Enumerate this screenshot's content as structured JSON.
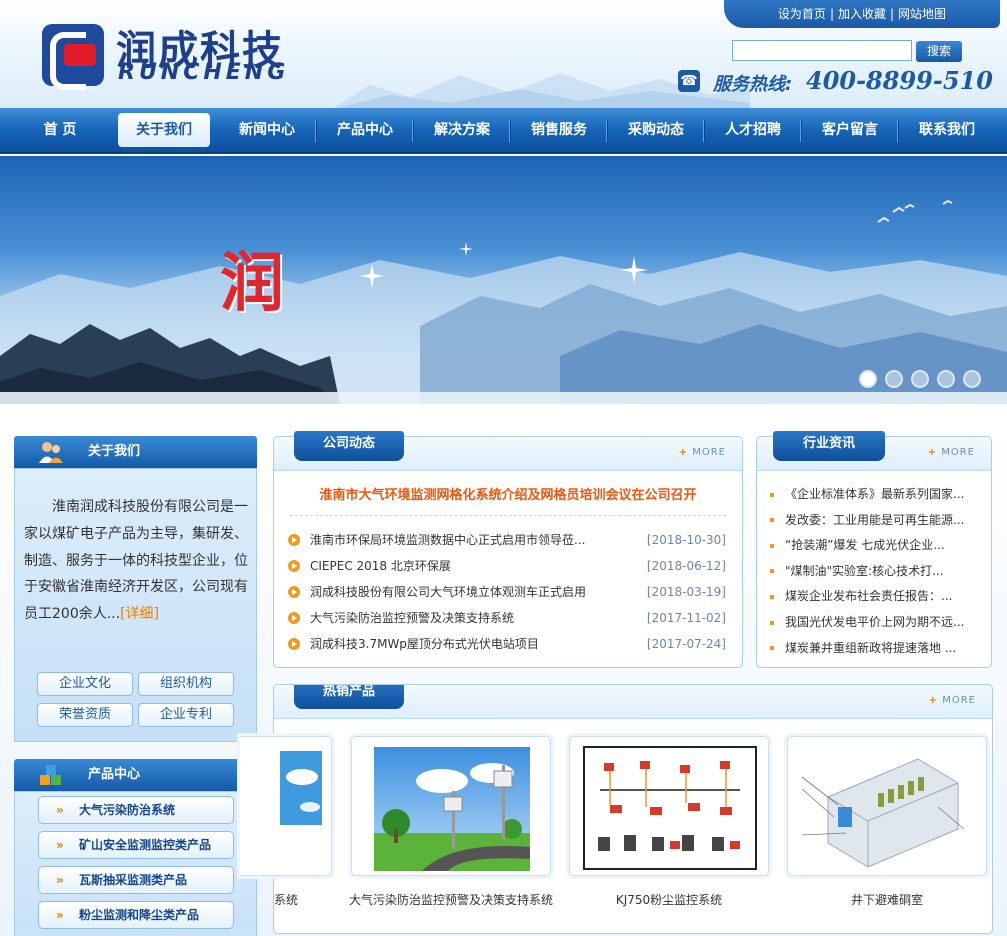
{
  "header": {
    "logo_cn": "润成科技",
    "logo_en": "RUNCHENG",
    "top_links": [
      "设为首页",
      "加入收藏",
      "网站地图"
    ],
    "search_button": "搜索",
    "search_value": "",
    "hotline_label": "服务热线:",
    "hotline_number": "400-8899-510"
  },
  "nav": [
    "首 页",
    "关于我们",
    "新闻中心",
    "产品中心",
    "解决方案",
    "销售服务",
    "采购动态",
    "人才招聘",
    "客户留言",
    "联系我们"
  ],
  "nav_active": 1,
  "banner": {
    "title": "润",
    "dots": 5,
    "active_dot": 0
  },
  "about": {
    "title": "关于我们",
    "text": "淮南润成科技股份有限公司是一家以煤矿电子产品为主导，集研发、制造、服务于一体的科技型企业，位于安徽省淮南经济开发区，公司现有员工200余人...",
    "detail": "[详细]",
    "links": [
      "企业文化",
      "组织机构",
      "荣誉资质",
      "企业专利"
    ]
  },
  "products_side": {
    "title": "产品中心",
    "links": [
      "大气污染防治系统",
      "矿山安全监测监控类产品",
      "瓦斯抽采监测类产品",
      "粉尘监测和降尘类产品"
    ],
    "arrow": "»"
  },
  "company_news": {
    "title": "公司动态",
    "more": "MORE",
    "headline": "淮南市大气环境监测网格化系统介绍及网格员培训会议在公司召开",
    "items": [
      {
        "title": "淮南市环保局环境监测数据中心正式启用市领导莅...",
        "date": "[2018-10-30]"
      },
      {
        "title": "CIEPEC 2018 北京环保展",
        "date": "[2018-06-12]"
      },
      {
        "title": "润成科技股份有限公司大气环境立体观测车正式启用",
        "date": "[2018-03-19]"
      },
      {
        "title": "大气污染防治监控预警及决策支持系统",
        "date": "[2017-11-02]"
      },
      {
        "title": "润成科技3.7MWp屋顶分布式光伏电站项目",
        "date": "[2017-07-24]"
      }
    ]
  },
  "industry_news": {
    "title": "行业资讯",
    "more": "MORE",
    "items": [
      "《企业标准体系》最新系列国家...",
      "发改委：工业用能是可再生能源...",
      "“抢装潮”爆发 七成光伏企业...",
      "\"煤制油\"实验室:核心技术打...",
      "煤炭企业发布社会责任报告：...",
      "我国光伏发电平价上网为期不远...",
      "煤炭兼并重组新政将提速落地 ..."
    ]
  },
  "hot_products": {
    "title": "热销产品",
    "more": "MORE",
    "items": [
      {
        "caption": "系统"
      },
      {
        "caption": "大气污染防治监控预警及决策支持系统"
      },
      {
        "caption": "KJ750粉尘监控系统"
      },
      {
        "caption": "井下避难硐室"
      }
    ]
  },
  "colors": {
    "brand_blue": "#1664b8",
    "accent_orange": "#f07d00",
    "headline_red": "#f0560a",
    "logo_red": "#e21b2b"
  }
}
